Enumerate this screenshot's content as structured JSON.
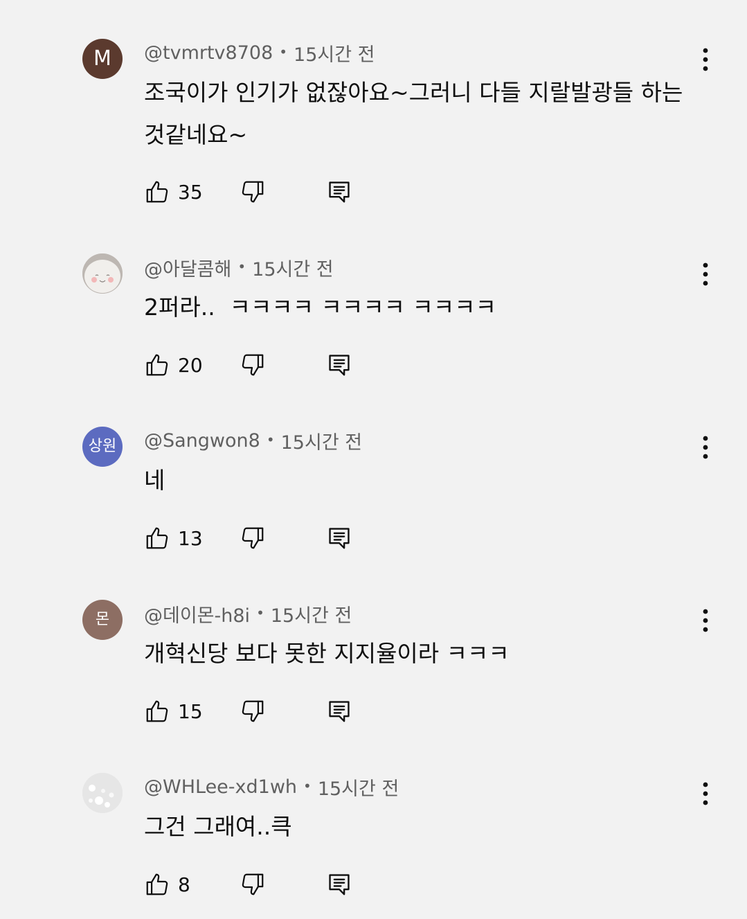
{
  "colors": {
    "background": "#f2f2f2",
    "text_primary": "#0f0f0f",
    "text_secondary": "#606060"
  },
  "separator": "•",
  "comments": [
    {
      "handle": "@tvmrtv8708",
      "time": "15시간 전",
      "text": "조국이가 인기가 없잖아요~그러니 다들 지랄발광들 하는 것같네요~",
      "likes": "35",
      "avatar": {
        "type": "initial",
        "initial": "M",
        "color": "#5b3a2e"
      }
    },
    {
      "handle": "@아달콤해",
      "time": "15시간 전",
      "text": "2퍼라..  ㅋㅋㅋㅋ ㅋㅋㅋㅋ ㅋㅋㅋㅋ",
      "likes": "20",
      "avatar": {
        "type": "image",
        "icon": "smiling-face-avatar-icon"
      }
    },
    {
      "handle": "@Sangwon8",
      "time": "15시간 전",
      "text": "네",
      "likes": "13",
      "avatar": {
        "type": "initial",
        "initial": "상원",
        "color": "#5c6bc0"
      }
    },
    {
      "handle": "@데이몬-h8i",
      "time": "15시간 전",
      "text": "개혁신당 보다 못한 지지율이라 ㅋㅋㅋ",
      "likes": "15",
      "avatar": {
        "type": "initial",
        "initial": "몬",
        "color": "#8d6e63"
      }
    },
    {
      "handle": "@WHLee-xd1wh",
      "time": "15시간 전",
      "text": "그건 그래여..큭",
      "likes": "8",
      "avatar": {
        "type": "image",
        "icon": "snowflake-avatar-icon"
      }
    }
  ]
}
